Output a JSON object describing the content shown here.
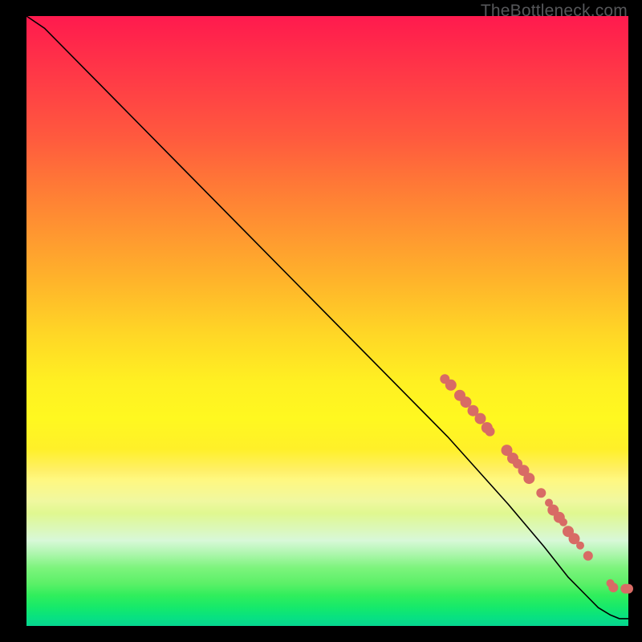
{
  "watermark": "TheBottleneck.com",
  "chart_data": {
    "type": "line",
    "title": "",
    "xlabel": "",
    "ylabel": "",
    "xlim": [
      0,
      100
    ],
    "ylim": [
      0,
      100
    ],
    "grid": false,
    "legend": false,
    "series": [
      {
        "name": "curve",
        "type": "line",
        "x": [
          0,
          3,
          6,
          10,
          16,
          24,
          34,
          46,
          58,
          70,
          80,
          86,
          90,
          93,
          95,
          97,
          98.5,
          100
        ],
        "y": [
          100,
          98,
          95,
          91,
          85,
          77,
          67,
          55,
          43,
          31,
          20,
          13,
          8,
          5,
          3,
          1.8,
          1.2,
          1.2
        ]
      },
      {
        "name": "markers",
        "type": "scatter",
        "points": [
          {
            "x": 69.5,
            "y": 40.5,
            "r": 6
          },
          {
            "x": 70.5,
            "y": 39.5,
            "r": 7
          },
          {
            "x": 72.0,
            "y": 37.8,
            "r": 7
          },
          {
            "x": 73.0,
            "y": 36.7,
            "r": 7
          },
          {
            "x": 74.2,
            "y": 35.3,
            "r": 7
          },
          {
            "x": 75.4,
            "y": 34.0,
            "r": 7
          },
          {
            "x": 76.5,
            "y": 32.5,
            "r": 7
          },
          {
            "x": 77.0,
            "y": 31.9,
            "r": 6
          },
          {
            "x": 79.8,
            "y": 28.8,
            "r": 7
          },
          {
            "x": 80.8,
            "y": 27.5,
            "r": 7
          },
          {
            "x": 81.6,
            "y": 26.6,
            "r": 6
          },
          {
            "x": 82.6,
            "y": 25.5,
            "r": 7
          },
          {
            "x": 83.5,
            "y": 24.2,
            "r": 7
          },
          {
            "x": 85.5,
            "y": 21.8,
            "r": 6
          },
          {
            "x": 86.8,
            "y": 20.2,
            "r": 5
          },
          {
            "x": 87.5,
            "y": 19.0,
            "r": 7
          },
          {
            "x": 88.5,
            "y": 17.8,
            "r": 7
          },
          {
            "x": 89.2,
            "y": 17.0,
            "r": 5
          },
          {
            "x": 90.0,
            "y": 15.5,
            "r": 7
          },
          {
            "x": 91.0,
            "y": 14.3,
            "r": 7
          },
          {
            "x": 92.0,
            "y": 13.2,
            "r": 5
          },
          {
            "x": 93.3,
            "y": 11.5,
            "r": 6
          },
          {
            "x": 97.0,
            "y": 7.0,
            "r": 5
          },
          {
            "x": 97.5,
            "y": 6.3,
            "r": 6
          },
          {
            "x": 99.5,
            "y": 6.1,
            "r": 6
          },
          {
            "x": 100.0,
            "y": 6.1,
            "r": 6
          }
        ]
      }
    ],
    "background_gradient": {
      "type": "vertical",
      "stops": [
        {
          "pos": 0.0,
          "color": "#ff1a4e"
        },
        {
          "pos": 0.28,
          "color": "#ff7a36"
        },
        {
          "pos": 0.52,
          "color": "#ffd626"
        },
        {
          "pos": 0.74,
          "color": "#fff068"
        },
        {
          "pos": 0.88,
          "color": "#aaf6aa"
        },
        {
          "pos": 1.0,
          "color": "#06d590"
        }
      ]
    }
  }
}
